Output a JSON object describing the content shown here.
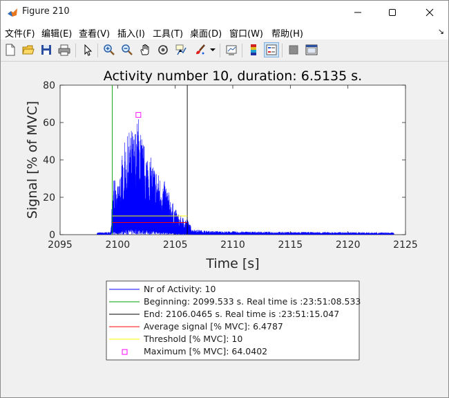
{
  "window": {
    "title": "Figure 210",
    "controls": [
      "minimize",
      "maximize",
      "close"
    ]
  },
  "menu": [
    {
      "label": "文件(F)"
    },
    {
      "label": "编辑(E)"
    },
    {
      "label": "查看(V)"
    },
    {
      "label": "插入(I)"
    },
    {
      "label": "工具(T)"
    },
    {
      "label": "桌面(D)"
    },
    {
      "label": "窗口(W)"
    },
    {
      "label": "帮助(H)"
    }
  ],
  "toolbar": [
    "new-figure-icon",
    "open-file-icon",
    "save-icon",
    "print-icon",
    "pointer-icon",
    "zoom-in-icon",
    "zoom-out-icon",
    "pan-hand-icon",
    "rotate-3d-icon",
    "data-cursor-icon",
    "brush-icon",
    "brush-dropdown-icon",
    "link-plot-icon",
    "colorbar-icon",
    "legend-icon",
    "hide-plot-tools-icon",
    "show-plot-tools-icon"
  ],
  "chart_data": {
    "type": "line",
    "title": "Activity number 10, duration: 6.5135 s.",
    "xlabel": "Time [s]",
    "ylabel": "Signal [% of MVC]",
    "xlim": [
      2095,
      2125
    ],
    "ylim": [
      0,
      80
    ],
    "xticks": [
      "2095",
      "2100",
      "2105",
      "2110",
      "2115",
      "2120",
      "2125"
    ],
    "yticks": [
      "0",
      "20",
      "40",
      "60",
      "80"
    ],
    "grid": false,
    "series": [
      {
        "name": "Nr of Activity: 10",
        "color": "#0000ff",
        "envelope": [
          [
            2098.2,
            1.2
          ],
          [
            2099.4,
            1.5
          ],
          [
            2099.6,
            38
          ],
          [
            2099.9,
            22
          ],
          [
            2100.2,
            35
          ],
          [
            2100.5,
            48
          ],
          [
            2100.8,
            52
          ],
          [
            2101.1,
            58
          ],
          [
            2101.4,
            55
          ],
          [
            2101.8,
            64.04
          ],
          [
            2102.2,
            50
          ],
          [
            2102.6,
            45
          ],
          [
            2103.0,
            40
          ],
          [
            2103.4,
            35
          ],
          [
            2103.8,
            30
          ],
          [
            2104.2,
            28
          ],
          [
            2104.6,
            20
          ],
          [
            2105.0,
            14
          ],
          [
            2105.4,
            10
          ],
          [
            2106.0,
            9
          ],
          [
            2106.5,
            3
          ],
          [
            2108.0,
            2
          ],
          [
            2110.0,
            1.8
          ],
          [
            2115.0,
            1.5
          ],
          [
            2120.0,
            1.4
          ],
          [
            2124.0,
            1.2
          ]
        ]
      },
      {
        "name": "Beginning: 2099.533 s. Real time is :23:51:08.533",
        "color": "#00a000",
        "x": 2099.533
      },
      {
        "name": "End: 2106.0465 s. Real time is :23:51:15.047",
        "color": "#000000",
        "x": 2106.0465
      },
      {
        "name": "Average signal [% MVC]: 6.4787",
        "color": "#ff0000",
        "y": 6.4787,
        "x_range": [
          2099.533,
          2106.0465
        ]
      },
      {
        "name": "Threshold [% MVC]: 10",
        "color": "#ffff00",
        "y": 10,
        "x_range": [
          2099.533,
          2106.0465
        ]
      },
      {
        "name": "Maximum [% MVC]: 64.0402",
        "color": "#ff00ff",
        "marker": "square",
        "x": 2101.8,
        "y": 64.0402
      }
    ],
    "legend_position": "bottom"
  }
}
